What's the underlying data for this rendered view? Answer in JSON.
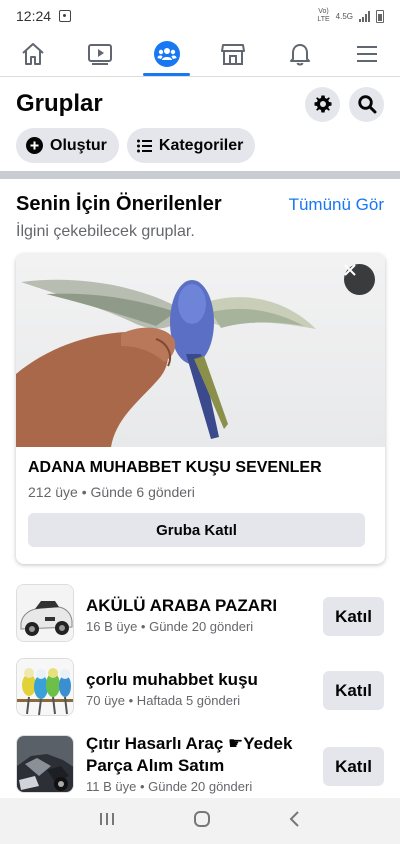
{
  "status_bar": {
    "time": "12:24",
    "network_top": "Vo)",
    "network_bottom": "LTE",
    "data_type": "4.5G"
  },
  "nav": {
    "tabs": [
      {
        "icon": "home-icon",
        "active": false
      },
      {
        "icon": "video-icon",
        "active": false
      },
      {
        "icon": "groups-icon",
        "active": true
      },
      {
        "icon": "marketplace-icon",
        "active": false
      },
      {
        "icon": "bell-icon",
        "active": false
      },
      {
        "icon": "menu-icon",
        "active": false
      }
    ],
    "accent": "#1877f2"
  },
  "header": {
    "title": "Gruplar",
    "settings_icon": "gear-icon",
    "search_icon": "search-icon"
  },
  "pills": {
    "create": "Oluştur",
    "categories": "Kategoriler"
  },
  "suggested": {
    "title": "Senin İçin Önerilenler",
    "see_all": "Tümünü Gör",
    "subtitle": "İlgini çekebilecek gruplar."
  },
  "featured": {
    "name": "ADANA MUHABBET KUŞU SEVENLER",
    "meta": "212 üye • Günde 6 gönderi",
    "join": "Gruba Katıl"
  },
  "groups": [
    {
      "name": "AKÜLÜ ARABA PAZARI",
      "meta": "16 B üye • Günde 20 gönderi",
      "join": "Katıl"
    },
    {
      "name": "çorlu muhabbet kuşu",
      "meta": "70 üye • Haftada 5 gönderi",
      "join": "Katıl"
    },
    {
      "name": "Çıtır Hasarlı Araç ☛Yedek Parça Alım Satım",
      "meta": "11 B üye • Günde 20 gönderi",
      "join": "Katıl"
    }
  ]
}
